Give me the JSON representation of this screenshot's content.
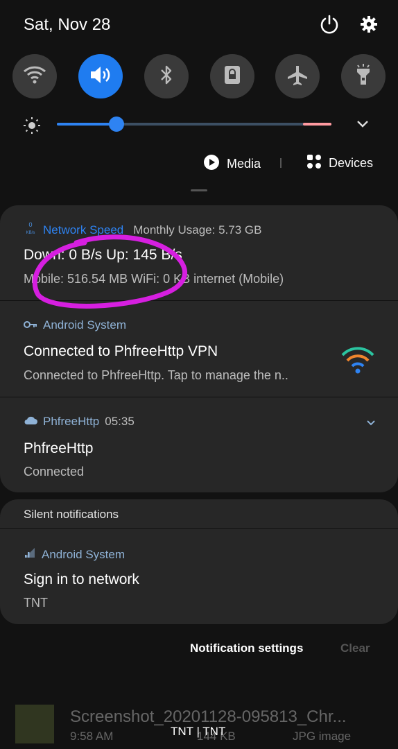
{
  "status": {
    "date": "Sat, Nov 28"
  },
  "quick_settings": {
    "tiles": [
      {
        "name": "wifi",
        "active": false
      },
      {
        "name": "sound",
        "active": true
      },
      {
        "name": "bluetooth",
        "active": false
      },
      {
        "name": "screen-lock",
        "active": false
      },
      {
        "name": "airplane",
        "active": false
      },
      {
        "name": "flashlight",
        "active": false
      }
    ],
    "brightness_level": 0.22,
    "media_label": "Media",
    "devices_label": "Devices"
  },
  "notifications": [
    {
      "app_name": "Network Speed",
      "app_extra": "Monthly Usage: 5.73 GB",
      "title": "Down: 0 B/s  Up: 145 B/s",
      "text": "Mobile: 516.54 MB  WiFi: 0 KB   internet (Mobile)"
    },
    {
      "app_name": "Android System",
      "title": "Connected to PhfreeHttp VPN",
      "text": "Connected to PhfreeHttp. Tap to manage the n.."
    },
    {
      "app_name": "PhfreeHttp",
      "time": "05:35",
      "title": "PhfreeHttp",
      "text": "Connected"
    }
  ],
  "silent": {
    "header": "Silent notifications",
    "app_name": "Android System",
    "title": "Sign in to network",
    "text": "TNT"
  },
  "footer": {
    "settings_label": "Notification settings",
    "clear_label": "Clear"
  },
  "background": {
    "file_name": "Screenshot_20201128-095813_Chr...",
    "time": "9:58 AM",
    "size": "144 KB",
    "type": "JPG image",
    "carrier": "TNT | TNT"
  },
  "colors": {
    "accent": "#1f7cf0",
    "annotation": "#d61fe0"
  }
}
